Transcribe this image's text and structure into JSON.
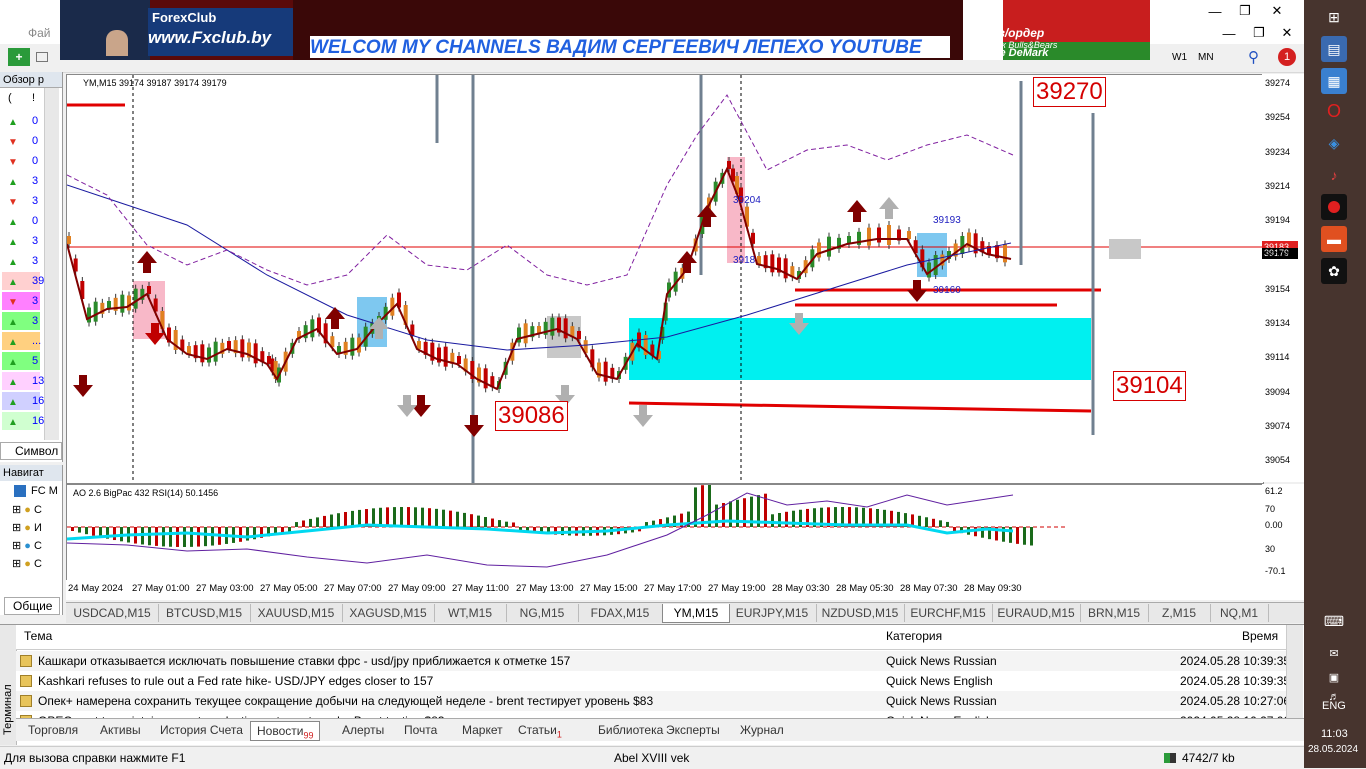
{
  "menu": {
    "file": "Фай"
  },
  "toolbar": {
    "tf_w1": "W1",
    "tf_mn": "MN",
    "notif_count": "1"
  },
  "banner": {
    "site": "www.Fxclub.by",
    "logo": "ForexClub",
    "headline": "WELCOM MY CHANNELS ВАДИМ СЕРГЕЕВИЧ ЛЕПЕХО YOUTUBE",
    "order_line1": "заказ/ордер",
    "order_line2": "стык Bulls&Bears",
    "order_line3": "Line DeMark"
  },
  "market_watch": {
    "title": "Обзор р",
    "col1": "(",
    "col2": "!",
    "rows": [
      {
        "dir": "up",
        "val": "0",
        "bg": "#ffffff"
      },
      {
        "dir": "down",
        "val": "0",
        "bg": "#ffffff"
      },
      {
        "dir": "down",
        "val": "0",
        "bg": "#ffffff"
      },
      {
        "dir": "up",
        "val": "3",
        "bg": "#ffffff"
      },
      {
        "dir": "down",
        "val": "3",
        "bg": "#ffffff"
      },
      {
        "dir": "up",
        "val": "0",
        "bg": "#ffffff"
      },
      {
        "dir": "up",
        "val": "3",
        "bg": "#ffffff"
      },
      {
        "dir": "up",
        "val": "3",
        "bg": "#ffffff"
      },
      {
        "dir": "up",
        "val": "39",
        "bg": "#ffd0d0"
      },
      {
        "dir": "down",
        "val": "3",
        "bg": "#ff80ff"
      },
      {
        "dir": "up",
        "val": "3",
        "bg": "#80ff80"
      },
      {
        "dir": "up",
        "val": "...",
        "bg": "#ffd080"
      },
      {
        "dir": "up",
        "val": "5",
        "bg": "#80ff80"
      },
      {
        "dir": "up",
        "val": "13",
        "bg": "#ffd0ff"
      },
      {
        "dir": "up",
        "val": "16",
        "bg": "#d0d0ff"
      },
      {
        "dir": "up",
        "val": "16",
        "bg": "#d0ffd0"
      }
    ],
    "tab_symbols": "Символ"
  },
  "navigator": {
    "title": "Навигат",
    "root": "FC M",
    "items": [
      "C",
      "И",
      "C",
      "C"
    ],
    "tab_common": "Общие"
  },
  "chart": {
    "header": "YM,M15  39174 39187 39174 39179",
    "osc_header": "AO 2.6  BigPac 432  RSI(14) 50.1456",
    "current_price": "39179",
    "bid_label": "39183",
    "level_labels": {
      "top": "39270",
      "right": "39104",
      "left": "39086"
    },
    "small_labels": {
      "a": "39204",
      "b": "3918",
      "c": "39193",
      "d": "39160"
    },
    "price_ticks": [
      "39274",
      "39254",
      "39234",
      "39214",
      "39194",
      "39174",
      "39154",
      "39134",
      "39114",
      "39094",
      "39074",
      "39054"
    ],
    "osc_ticks": [
      "61.2",
      "70",
      "0.00",
      "30",
      "-70.1"
    ],
    "time_ticks": [
      "24 May 2024",
      "27 May 01:00",
      "27 May 03:00",
      "27 May 05:00",
      "27 May 07:00",
      "27 May 09:00",
      "27 May 11:00",
      "27 May 13:00",
      "27 May 15:00",
      "27 May 17:00",
      "27 May 19:00",
      "28 May 03:30",
      "28 May 05:30",
      "28 May 07:30",
      "28 May 09:30"
    ]
  },
  "symbol_tabs": [
    "USDCAD,M15",
    "BTCUSD,M15",
    "XAUUSD,M15",
    "XAGUSD,M15",
    "WT,M15",
    "NG,M15",
    "FDAX,M15",
    "YM,M15",
    "EURJPY,M15",
    "NZDUSD,M15",
    "EURCHF,M15",
    "EURAUD,M15",
    "BRN,M15",
    "Z,M15",
    "NQ,M1"
  ],
  "terminal": {
    "side_label": "Терминал",
    "col_topic": "Тема",
    "col_category": "Категория",
    "col_time": "Время",
    "news": [
      {
        "topic": "Кашкари отказывается исключать повышение ставки фрс - usd/jpy приближается к отметке 157",
        "category": "Quick News Russian",
        "time": "2024.05.28 10:39:35"
      },
      {
        "topic": "Kashkari refuses to rule out a Fed rate hike- USD/JPY edges closer to 157",
        "category": "Quick News English",
        "time": "2024.05.28 10:39:35"
      },
      {
        "topic": "Опек+ намерена сохранить текущее сокращение добычи на следующей неделе - brent тестирует уровень $83",
        "category": "Quick News Russian",
        "time": "2024.05.28 10:27:06"
      },
      {
        "topic": "OPEC+ set to maintain current production cuts next week - Brent testing $83",
        "category": "Quick News English",
        "time": "2024.05.28 10:27:06"
      }
    ],
    "tabs": [
      "Торговля",
      "Активы",
      "История Счета",
      "Новости",
      "Алерты",
      "Почта",
      "Маркет",
      "Статьи",
      "Библиотека",
      "Эксперты",
      "Журнал"
    ],
    "news_badge": "99",
    "articles_badge": "1"
  },
  "status": {
    "help": "Для вызова справки нажмите F1",
    "profile": "Abel XVIII vek",
    "traffic": "4742/7 kb"
  },
  "taskbar": {
    "lang": "ENG",
    "time": "11:03",
    "date": "28.05.2024"
  }
}
